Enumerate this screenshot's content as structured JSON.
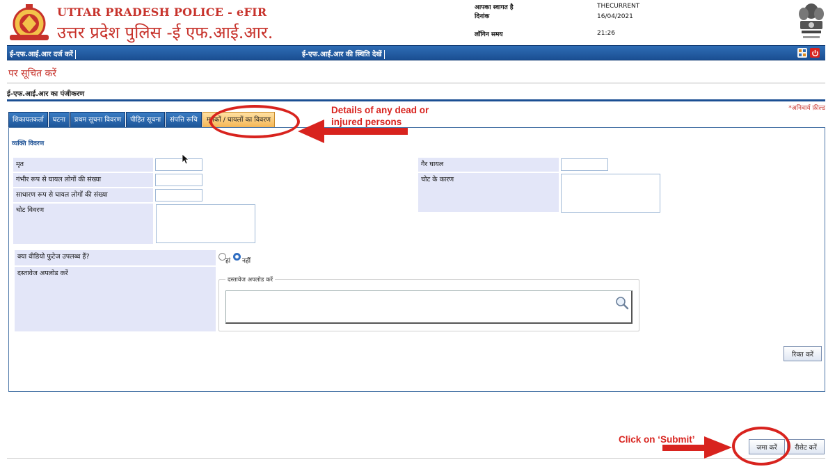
{
  "header": {
    "brand_en": "UTTAR PRADESH POLICE - eFIR",
    "brand_hi": "उत्तर प्रदेश पुलिस -ई एफ.आई.आर.",
    "welcome_label": "आपका स्वागत है",
    "welcome_value": "THECURRENT",
    "date_label": "दिनांक",
    "date_value": "16/04/2021",
    "login_time_label": "लॉगिन समय",
    "login_time_value": "21:26"
  },
  "nav": {
    "register_label": "ई-एफ.आई.आर दर्ज करें",
    "status_label": "ई-एफ.आई.आर की स्थिति देखें",
    "icons": [
      "sitemap-icon",
      "power-icon"
    ]
  },
  "page": {
    "title": "पर सूचित करें",
    "section_title": "ई-एफ.आई.आर का पंजीकरण",
    "required_note": "*अनिवार्य फ़ील्ड"
  },
  "tabs": [
    {
      "label": "शिकायतकर्ता"
    },
    {
      "label": "घटना"
    },
    {
      "label": "प्रथम सूचना विवरण"
    },
    {
      "label": "पीड़ित सूचना"
    },
    {
      "label": "संपत्ति रूचि"
    },
    {
      "label": "मृतकों / घायलों का विवरण"
    }
  ],
  "form": {
    "legend": "व्यक्ति विवरण",
    "dead_label": "मृत",
    "serious_injured_label": "गंभीर रूप से घायल लोगों की संख्या",
    "minor_injured_label": "साधारण रूप से घायल लोगों की संख्या",
    "injury_details_label": "चोट विवरण",
    "non_injured_label": "गैर घायल",
    "injury_cause_label": "चोट के कारण",
    "video_question": "क्या वीडियो फुटेज उपलब्ध हैं?",
    "yes_label": "हां",
    "no_label": "नहीं",
    "upload_label": "दस्तावेज अपलोड करें",
    "upload_legend": "दस्तावेज अपलोड करें",
    "clear_button": "रिक्त करें"
  },
  "footer": {
    "submit_button": "जमा करें",
    "reset_button": "रीसेट करें"
  },
  "annotations": {
    "dead_injured_note_line1": "Details of any dead or",
    "dead_injured_note_line2": "injured persons",
    "submit_note": "Click on ‘Submit’"
  },
  "colors": {
    "brand_red": "#c7322b",
    "nav_blue": "#1b4f93",
    "label_bg": "#e3e6f8",
    "active_tab": "#f5b656",
    "annotation_red": "#d8231e"
  }
}
